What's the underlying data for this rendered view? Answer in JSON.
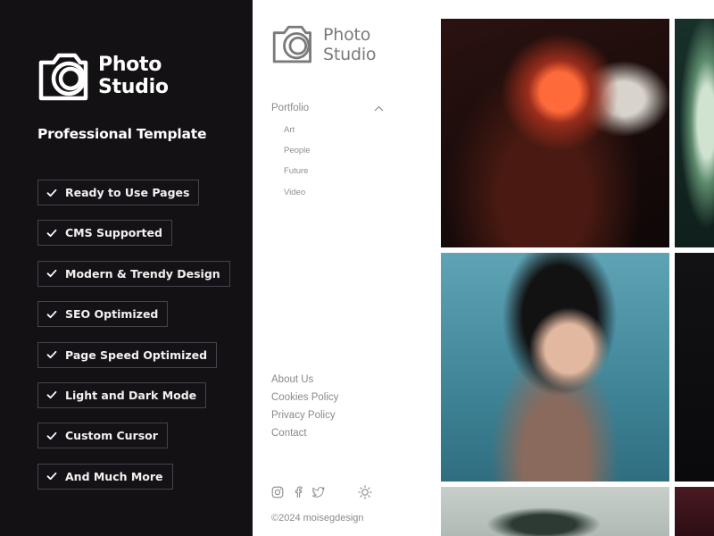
{
  "promo": {
    "logo_line1": "Photo",
    "logo_line2": "Studio",
    "tagline": "Professional Template",
    "features": [
      "Ready to Use Pages",
      "CMS Supported",
      "Modern & Trendy Design",
      "SEO Optimized",
      "Page Speed Optimized",
      "Light and Dark Mode",
      "Custom Cursor",
      "And Much More"
    ]
  },
  "site": {
    "logo_line1": "Photo",
    "logo_line2": "Studio",
    "nav": {
      "heading": "Portfolio",
      "items": [
        "Art",
        "People",
        "Future",
        "Video"
      ]
    },
    "footer_links": [
      "About Us",
      "Cookies Policy",
      "Privacy Policy",
      "Contact"
    ],
    "socials": [
      "instagram-icon",
      "facebook-icon",
      "twitter-icon"
    ],
    "theme_toggle_icon": "sun-icon",
    "copyright": "©2024 moisegdesign"
  },
  "gallery": {
    "images": [
      "portrait-glowing-mask",
      "floral-sculpture",
      "woman-mirror-portrait",
      "dark-image",
      "abstract-figure",
      "red-abstract"
    ]
  },
  "colors": {
    "promo_bg": "#131113",
    "feature_border": "#45434a",
    "site_text": "#8a8a8a"
  }
}
